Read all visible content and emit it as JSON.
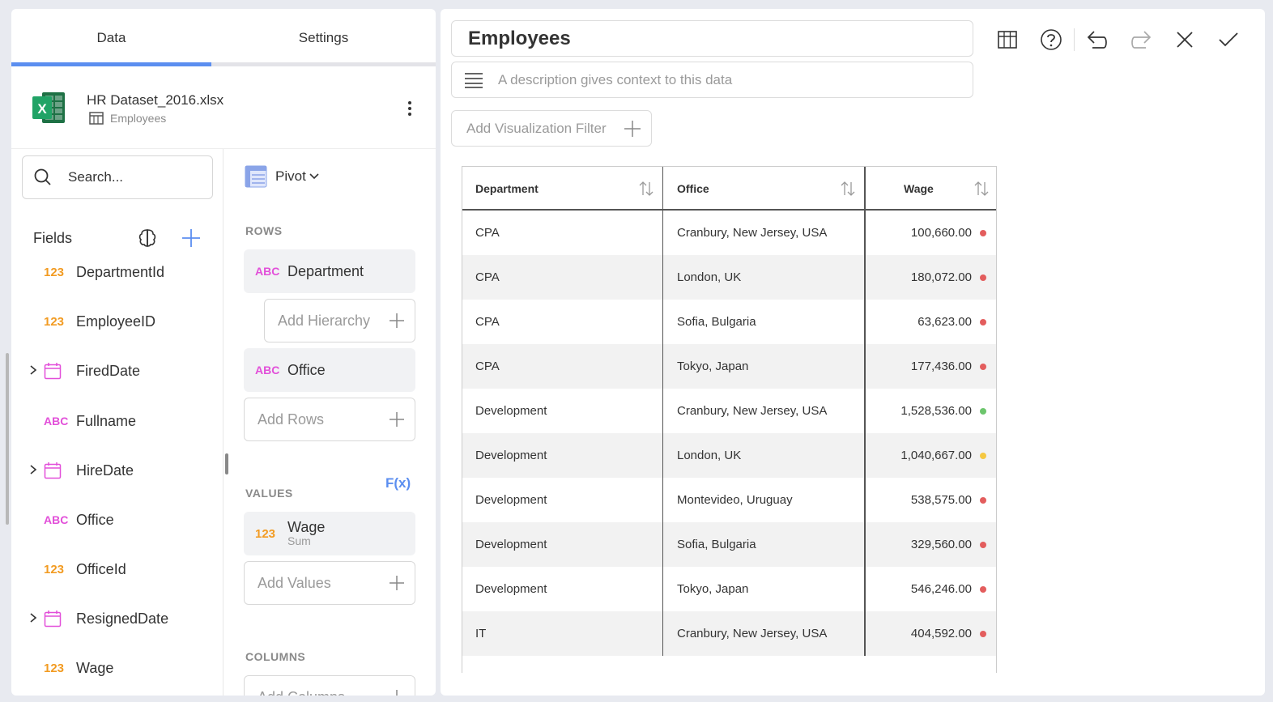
{
  "left": {
    "tabs": [
      {
        "label": "Data",
        "active": true
      },
      {
        "label": "Settings",
        "active": false
      }
    ],
    "datasource": {
      "file_name": "HR Dataset_2016.xlsx",
      "sheet_name": "Employees",
      "icon": "excel-icon"
    },
    "search": {
      "placeholder": "Search..."
    },
    "fields_title": "Fields",
    "fields": [
      {
        "type": "123",
        "label": "DepartmentId",
        "expandable": false
      },
      {
        "type": "123",
        "label": "EmployeeID",
        "expandable": false
      },
      {
        "type": "date",
        "label": "FiredDate",
        "expandable": true
      },
      {
        "type": "ABC",
        "label": "Fullname",
        "expandable": false
      },
      {
        "type": "date",
        "label": "HireDate",
        "expandable": true
      },
      {
        "type": "ABC",
        "label": "Office",
        "expandable": false
      },
      {
        "type": "123",
        "label": "OfficeId",
        "expandable": false
      },
      {
        "type": "date",
        "label": "ResignedDate",
        "expandable": true
      },
      {
        "type": "123",
        "label": "Wage",
        "expandable": false
      }
    ],
    "pivot": {
      "label": "Pivot",
      "rows_label": "ROWS",
      "rows": [
        {
          "type": "ABC",
          "label": "Department"
        },
        {
          "type": "ABC",
          "label": "Office"
        }
      ],
      "add_hierarchy": "Add Hierarchy",
      "add_rows": "Add Rows",
      "values_label": "VALUES",
      "fx_label": "F(x)",
      "values": [
        {
          "type": "123",
          "label": "Wage",
          "sub": "Sum"
        }
      ],
      "add_values": "Add Values",
      "columns_label": "COLUMNS",
      "add_columns": "Add Columns"
    }
  },
  "right": {
    "title": "Employees",
    "description_placeholder": "A description gives context to this data",
    "add_filter": "Add Visualization Filter",
    "table": {
      "columns": [
        "Department",
        "Office",
        "Wage"
      ],
      "rows": [
        {
          "department": "CPA",
          "office": "Cranbury, New Jersey, USA",
          "wage": "100,660.00",
          "status": "red"
        },
        {
          "department": "CPA",
          "office": "London, UK",
          "wage": "180,072.00",
          "status": "red"
        },
        {
          "department": "CPA",
          "office": "Sofia, Bulgaria",
          "wage": "63,623.00",
          "status": "red"
        },
        {
          "department": "CPA",
          "office": "Tokyo, Japan",
          "wage": "177,436.00",
          "status": "red"
        },
        {
          "department": "Development",
          "office": "Cranbury, New Jersey, USA",
          "wage": "1,528,536.00",
          "status": "green"
        },
        {
          "department": "Development",
          "office": "London, UK",
          "wage": "1,040,667.00",
          "status": "yellow"
        },
        {
          "department": "Development",
          "office": "Montevideo, Uruguay",
          "wage": "538,575.00",
          "status": "red"
        },
        {
          "department": "Development",
          "office": "Sofia, Bulgaria",
          "wage": "329,560.00",
          "status": "red"
        },
        {
          "department": "Development",
          "office": "Tokyo, Japan",
          "wage": "546,246.00",
          "status": "red"
        },
        {
          "department": "IT",
          "office": "Cranbury, New Jersey, USA",
          "wage": "404,592.00",
          "status": "red"
        }
      ]
    }
  },
  "colors": {
    "accent": "#5b8ef0",
    "number_type": "#f29b22",
    "text_type": "#e24fd9",
    "date_type": "#e24fd9",
    "status_red": "#e35d5d",
    "status_green": "#6cc56c",
    "status_yellow": "#f5c842"
  }
}
